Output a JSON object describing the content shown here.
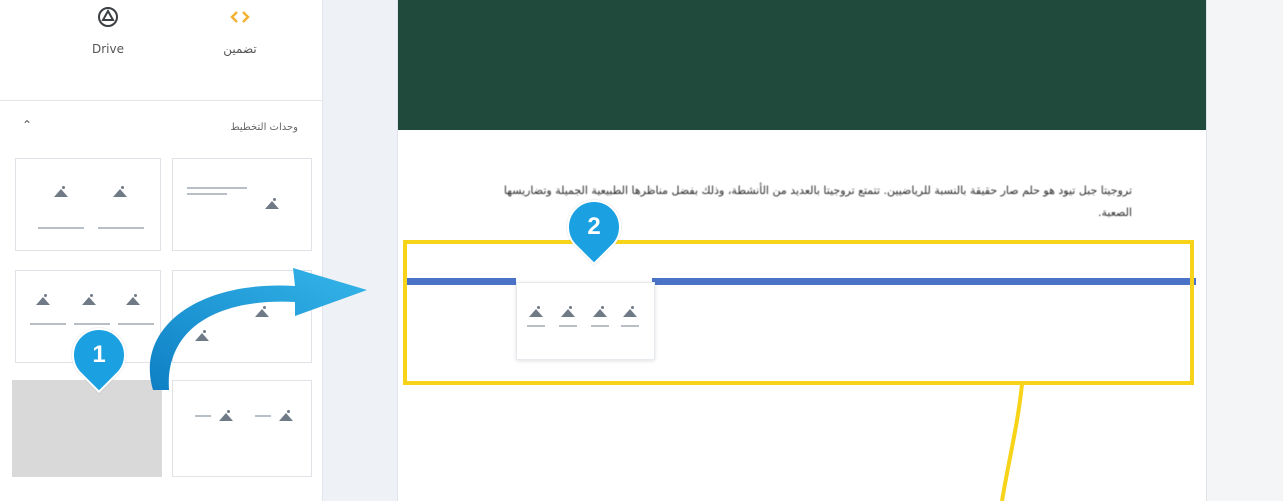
{
  "toolbar": {
    "drive_label": "Drive",
    "insert_label": "تضمين",
    "drive_icon": "drive-icon",
    "insert_icon": "embed-icon"
  },
  "layouts_section": {
    "title": "وحدات التخطيط",
    "collapse_icon": "chevron-up-icon"
  },
  "page": {
    "banner_color": "#1f4a3c",
    "paragraph": "تروجيتا جبل تيود هو حلم صار حقيقة بالنسبة للرياضيين. تتمتع تروجيتا بالعديد من الأنشطة، وذلك بفضل مناظرها الطبيعية الجميلة وتضاريسها الصعبة."
  },
  "callouts": {
    "step1": "1",
    "step2": "2",
    "badge_color": "#1ba1e2",
    "highlight_color": "#f7d31a",
    "arrow_color": "#1ba1e2"
  }
}
